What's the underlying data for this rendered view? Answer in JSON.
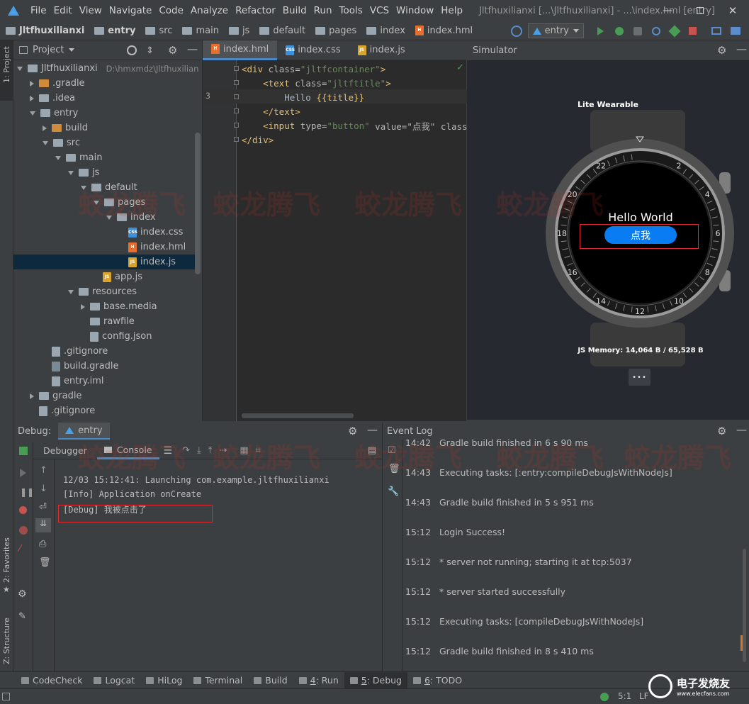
{
  "window": {
    "title": "Jltfhuxilianxi [...\\Jltfhuxilianxi] - ...\\index.hml [entry]",
    "menu": [
      "File",
      "Edit",
      "View",
      "Navigate",
      "Code",
      "Analyze",
      "Refactor",
      "Build",
      "Run",
      "Tools",
      "VCS",
      "Window",
      "Help"
    ]
  },
  "breadcrumb": [
    "Jltfhuxilianxi",
    "entry",
    "src",
    "main",
    "js",
    "default",
    "pages",
    "index",
    "index.hml"
  ],
  "run_config": "entry",
  "project": {
    "title": "Project",
    "root_label": "Jltfhuxilianxi",
    "root_path": "D:\\hmxmdz\\Jltfhuxilian",
    "tree": [
      {
        "label": ".gradle",
        "depth": 1,
        "arrow": "right",
        "kind": "folder-orange"
      },
      {
        "label": ".idea",
        "depth": 1,
        "arrow": "right",
        "kind": "folder"
      },
      {
        "label": "entry",
        "depth": 1,
        "arrow": "down",
        "kind": "folder"
      },
      {
        "label": "build",
        "depth": 2,
        "arrow": "right",
        "kind": "folder-orange"
      },
      {
        "label": "src",
        "depth": 2,
        "arrow": "down",
        "kind": "folder"
      },
      {
        "label": "main",
        "depth": 3,
        "arrow": "down",
        "kind": "folder"
      },
      {
        "label": "js",
        "depth": 4,
        "arrow": "down",
        "kind": "folder"
      },
      {
        "label": "default",
        "depth": 5,
        "arrow": "down",
        "kind": "folder"
      },
      {
        "label": "pages",
        "depth": 6,
        "arrow": "down",
        "kind": "folder"
      },
      {
        "label": "index",
        "depth": 7,
        "arrow": "down",
        "kind": "folder"
      },
      {
        "label": "index.css",
        "depth": 8,
        "arrow": "none",
        "kind": "css"
      },
      {
        "label": "index.hml",
        "depth": 8,
        "arrow": "none",
        "kind": "html"
      },
      {
        "label": "index.js",
        "depth": 8,
        "arrow": "none",
        "kind": "js",
        "selected": true
      },
      {
        "label": "app.js",
        "depth": 6,
        "arrow": "none",
        "kind": "js"
      },
      {
        "label": "resources",
        "depth": 4,
        "arrow": "down",
        "kind": "folder"
      },
      {
        "label": "base.media",
        "depth": 5,
        "arrow": "right",
        "kind": "folder"
      },
      {
        "label": "rawfile",
        "depth": 5,
        "arrow": "none",
        "kind": "folder"
      },
      {
        "label": "config.json",
        "depth": 5,
        "arrow": "none",
        "kind": "json"
      },
      {
        "label": ".gitignore",
        "depth": 2,
        "arrow": "none",
        "kind": "text"
      },
      {
        "label": "build.gradle",
        "depth": 2,
        "arrow": "none",
        "kind": "gradle"
      },
      {
        "label": "entry.iml",
        "depth": 2,
        "arrow": "none",
        "kind": "text"
      },
      {
        "label": "gradle",
        "depth": 1,
        "arrow": "right",
        "kind": "folder"
      },
      {
        "label": ".gitignore",
        "depth": 1,
        "arrow": "none",
        "kind": "text"
      }
    ]
  },
  "editor": {
    "tabs": [
      {
        "label": "index.hml",
        "kind": "html",
        "active": true
      },
      {
        "label": "index.css",
        "kind": "css",
        "active": false
      },
      {
        "label": "index.js",
        "kind": "js",
        "active": false
      }
    ],
    "current_line": "3",
    "lines": [
      [
        "<div ",
        "class=",
        "\"jltfcontainer\"",
        ">"
      ],
      [
        "    <text ",
        "class=",
        "\"jltftitle\"",
        ">"
      ],
      [
        "        Hello ",
        "{{title}}",
        "",
        ""
      ],
      [
        "    </text>",
        "",
        "",
        ""
      ],
      [
        "    <input ",
        "type=",
        "\"button\"",
        " value=\"点我\" class=\"j"
      ],
      [
        "</div>",
        "",
        "",
        ""
      ]
    ]
  },
  "simulator": {
    "title": "Simulator",
    "device": "Lite Wearable",
    "screen_text": "Hello World",
    "button_label": "点我",
    "memory": "JS Memory: 14,064 B / 65,528 B",
    "more": "•••",
    "dial_numbers": [
      "2",
      "4",
      "6",
      "8",
      "10",
      "12",
      "14",
      "16",
      "18",
      "20",
      "22"
    ]
  },
  "debug": {
    "title": "Debug:",
    "config": "entry",
    "tabs": [
      "Debugger",
      "Console"
    ],
    "console": [
      "12/03 15:12:41: Launching com.example.jltfhuxilianxi",
      "[Info] Application onCreate",
      "[Debug] 我被点击了"
    ]
  },
  "event_log": {
    "title": "Event Log",
    "entries": [
      {
        "time": "14:42",
        "text": "Gradle build finished in 6 s 90 ms"
      },
      {
        "time": "14:43",
        "text": "Executing tasks: [:entry:compileDebugJsWithNodeJs]"
      },
      {
        "time": "14:43",
        "text": "Gradle build finished in 5 s 951 ms"
      },
      {
        "time": "15:12",
        "text": "Login Success!"
      },
      {
        "time": "15:12",
        "text": "* server not running; starting it at tcp:5037"
      },
      {
        "time": "15:12",
        "text": "* server started successfully"
      },
      {
        "time": "15:12",
        "text": "Executing tasks: [compileDebugJsWithNodeJs]"
      },
      {
        "time": "15:12",
        "text": "Gradle build finished in 8 s 410 ms"
      }
    ]
  },
  "tool_windows": [
    {
      "label": "CodeCheck",
      "key": "",
      "icon": "codecheck-icon"
    },
    {
      "label": "Logcat",
      "key": "",
      "icon": "logcat-icon"
    },
    {
      "label": "HiLog",
      "key": "",
      "icon": "hilog-icon"
    },
    {
      "label": "Terminal",
      "key": "",
      "icon": "terminal-icon"
    },
    {
      "label": "Build",
      "key": "",
      "icon": "build-icon"
    },
    {
      "label": ": Run",
      "key": "4",
      "icon": "run-icon"
    },
    {
      "label": ": Debug",
      "key": "5",
      "icon": "debug-icon",
      "active": true
    },
    {
      "label": ": TODO",
      "key": "6",
      "icon": "todo-icon"
    }
  ],
  "side_tabs": {
    "project": "1: Project",
    "favorites": "2: Favorites",
    "structure": "Z: Structure"
  },
  "status": {
    "position": "5:1",
    "line_ending": "LF"
  },
  "watermark": {
    "text": "蛟龙腾飞",
    "brand": "电子发烧友",
    "brand_url": "www.elecfans.com"
  }
}
